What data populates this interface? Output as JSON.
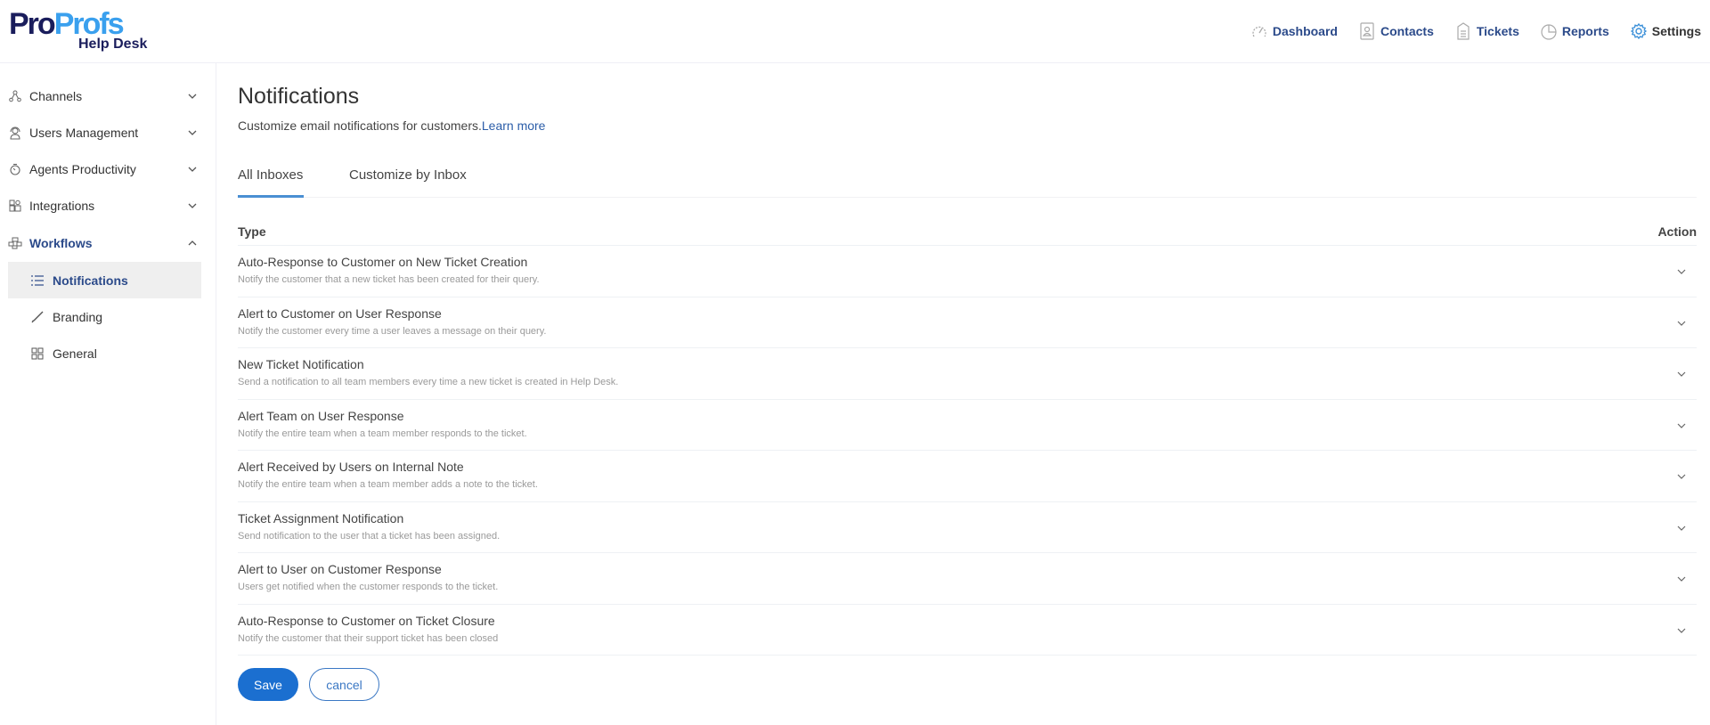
{
  "brand": {
    "logo_pro": "Pro",
    "logo_profs": "Profs",
    "logo_sub": "Help Desk",
    "colors": {
      "navy": "#1a1d5c",
      "light_blue": "#3aa0ee",
      "accent": "#1b6fd0",
      "link": "#2b5da8"
    }
  },
  "topnav": [
    {
      "label": "Dashboard",
      "icon": "speedometer-icon"
    },
    {
      "label": "Contacts",
      "icon": "contact-card-icon"
    },
    {
      "label": "Tickets",
      "icon": "ticket-icon"
    },
    {
      "label": "Reports",
      "icon": "pie-chart-icon"
    },
    {
      "label": "Settings",
      "icon": "gear-icon"
    }
  ],
  "sidebar": {
    "items": [
      {
        "label": "Channels",
        "icon": "channels-icon",
        "expanded": false
      },
      {
        "label": "Users Management",
        "icon": "headset-user-icon",
        "expanded": false
      },
      {
        "label": "Agents Productivity",
        "icon": "stopwatch-icon",
        "expanded": false
      },
      {
        "label": "Integrations",
        "icon": "integrations-icon",
        "expanded": false
      },
      {
        "label": "Workflows",
        "icon": "workflows-icon",
        "expanded": true
      }
    ],
    "subitems": [
      {
        "label": "Notifications",
        "icon": "list-icon",
        "selected": true
      },
      {
        "label": "Branding",
        "icon": "brush-icon",
        "selected": false
      },
      {
        "label": "General",
        "icon": "grid-icon",
        "selected": false
      }
    ]
  },
  "main": {
    "title": "Notifications",
    "description": "Customize email notifications for customers.",
    "learn_more": "Learn more",
    "tabs": [
      {
        "label": "All Inboxes",
        "active": true
      },
      {
        "label": "Customize by Inbox",
        "active": false
      }
    ],
    "table": {
      "col_type": "Type",
      "col_action": "Action",
      "rows": [
        {
          "title": "Auto-Response to Customer on New Ticket Creation",
          "desc": "Notify the customer that a new ticket has been created for their query."
        },
        {
          "title": "Alert to Customer on User Response",
          "desc": "Notify the customer every time a user leaves a message on their query."
        },
        {
          "title": "New Ticket Notification",
          "desc": "Send a notification to all team members every time a new ticket is created in Help Desk."
        },
        {
          "title": "Alert Team on User Response",
          "desc": "Notify the entire team when a team member responds to the ticket."
        },
        {
          "title": "Alert Received by Users on Internal Note",
          "desc": "Notify the entire team when a team member adds a note to the ticket."
        },
        {
          "title": "Ticket Assignment Notification",
          "desc": "Send notification to the user that a ticket has been assigned."
        },
        {
          "title": "Alert to User on Customer Response",
          "desc": "Users get notified when the customer responds to the ticket."
        },
        {
          "title": "Auto-Response to Customer on Ticket Closure",
          "desc": "Notify the customer that their support ticket has been closed"
        }
      ]
    },
    "save_label": "Save",
    "cancel_label": "cancel"
  }
}
